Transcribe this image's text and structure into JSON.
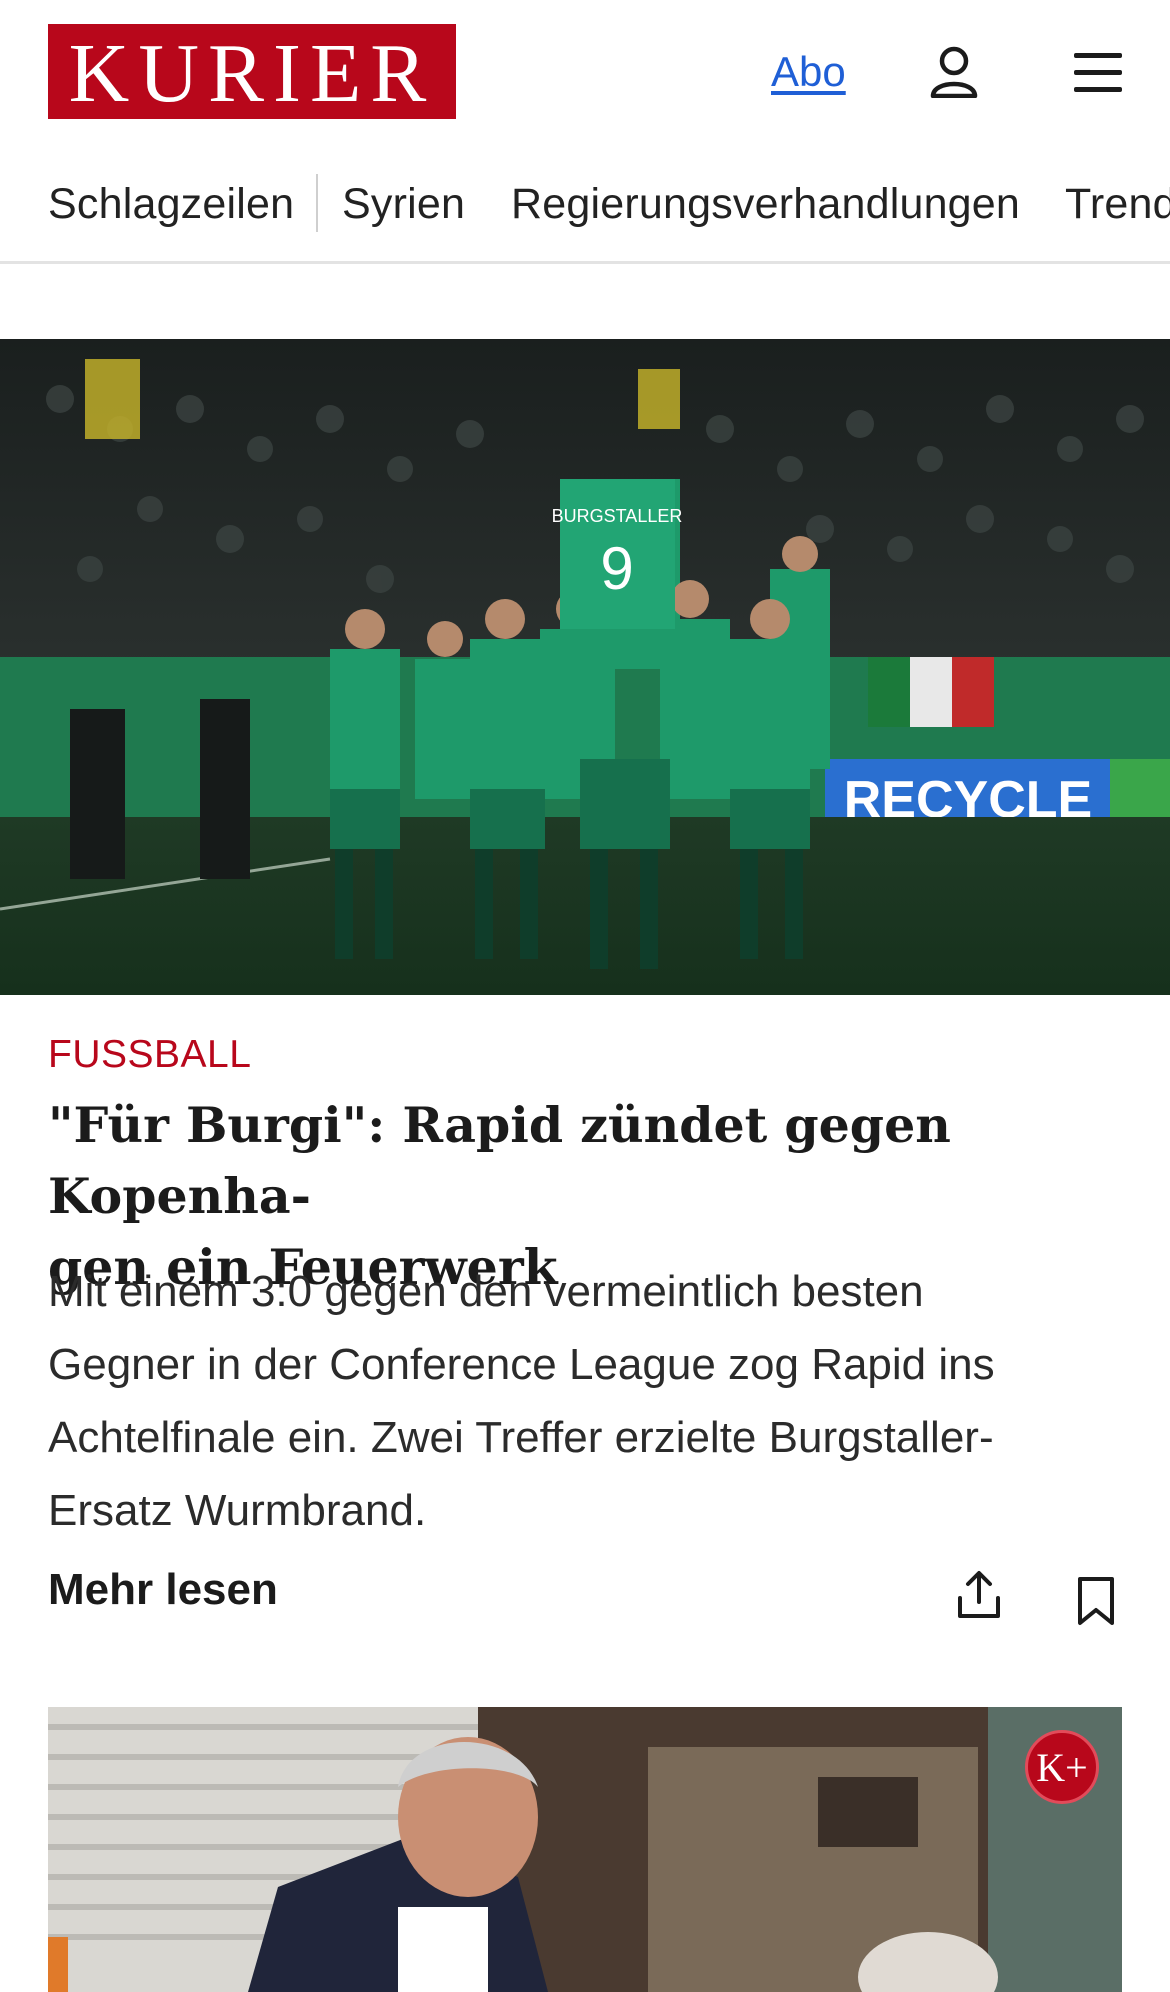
{
  "header": {
    "logo_text": "KURIER",
    "abo_label": "Abo",
    "brand_color": "#b8071b",
    "link_color": "#1f5fd6",
    "icons": [
      "user-icon",
      "menu-icon"
    ]
  },
  "nav": {
    "items": [
      {
        "label": "Schlagzeilen"
      },
      {
        "label": "Syrien"
      },
      {
        "label": "Regierungsverhandlungen"
      },
      {
        "label": "Trends"
      }
    ]
  },
  "article": {
    "kicker": "FUSSBALL",
    "headline_line1": "\"Für Burgi\": Rapid zündet gegen Kopenha-",
    "headline_line2": "gen ein Feuerwerk",
    "teaser_line1": "Mit einem 3:0 gegen den vermeintlich besten",
    "teaser_line2": "Gegner in der Conference League zog Rapid ins",
    "teaser_line3": "Achtelfinale ein. Zwei Treffer erzielte Burgstaller-",
    "teaser_line4": "Ersatz Wurmbrand.",
    "more_label": "Mehr lesen",
    "icons": [
      "share-icon",
      "bookmark-icon"
    ],
    "image_texts": {
      "jersey_name": "BURGSTALLER",
      "jersey_number": "9",
      "board_text": "RECYCLE"
    }
  },
  "second_article": {
    "badge": "K+"
  }
}
